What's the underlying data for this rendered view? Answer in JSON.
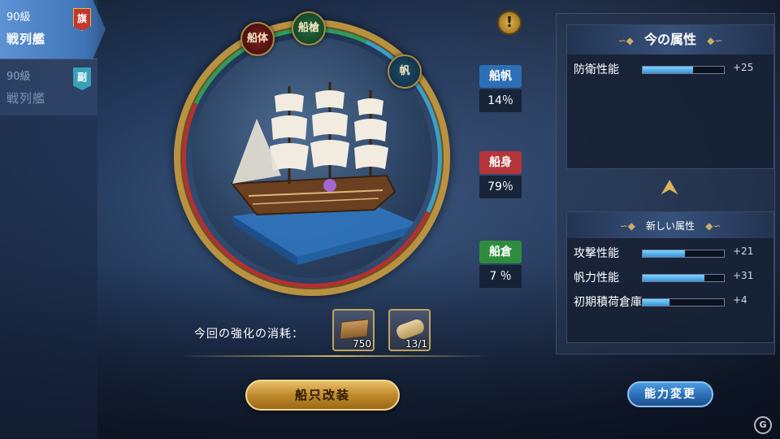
{
  "ship_list": [
    {
      "level": "90級",
      "type": "戦列艦",
      "badge": "旗",
      "active": true
    },
    {
      "level": "90級",
      "type": "戦列艦",
      "badge": "副",
      "active": false
    }
  ],
  "ring": {
    "hull_button": "船体",
    "cannon_button": "船槍",
    "sail_button": "帆"
  },
  "alert": "!",
  "stats": {
    "sail": {
      "label": "船帆",
      "value": "14％",
      "color": "#2d6fb5"
    },
    "hull": {
      "label": "船身",
      "value": "79％",
      "color": "#b4353a"
    },
    "cargo": {
      "label": "船倉",
      "value": "7 ％",
      "color": "#2f8c3f"
    }
  },
  "cost": {
    "label": "今回の強化の消耗：",
    "items": [
      {
        "icon": "wood-planks-icon",
        "count": "750"
      },
      {
        "icon": "scroll-icon",
        "count": "13/1"
      }
    ]
  },
  "remodel_button": "船只改装",
  "ability_button": "能力変更",
  "current_attributes": {
    "title": "今の属性",
    "rows": [
      {
        "name": "防衛性能",
        "value": "+25",
        "fill": 0.62
      }
    ]
  },
  "new_attributes": {
    "title": "新しい属性",
    "rows": [
      {
        "name": "攻撃性能",
        "value": "+21",
        "fill": 0.52
      },
      {
        "name": "帆力性能",
        "value": "+31",
        "fill": 0.76
      },
      {
        "name": "初期積荷倉庫",
        "value": "+4",
        "fill": 0.33
      }
    ]
  },
  "watermark": "G"
}
